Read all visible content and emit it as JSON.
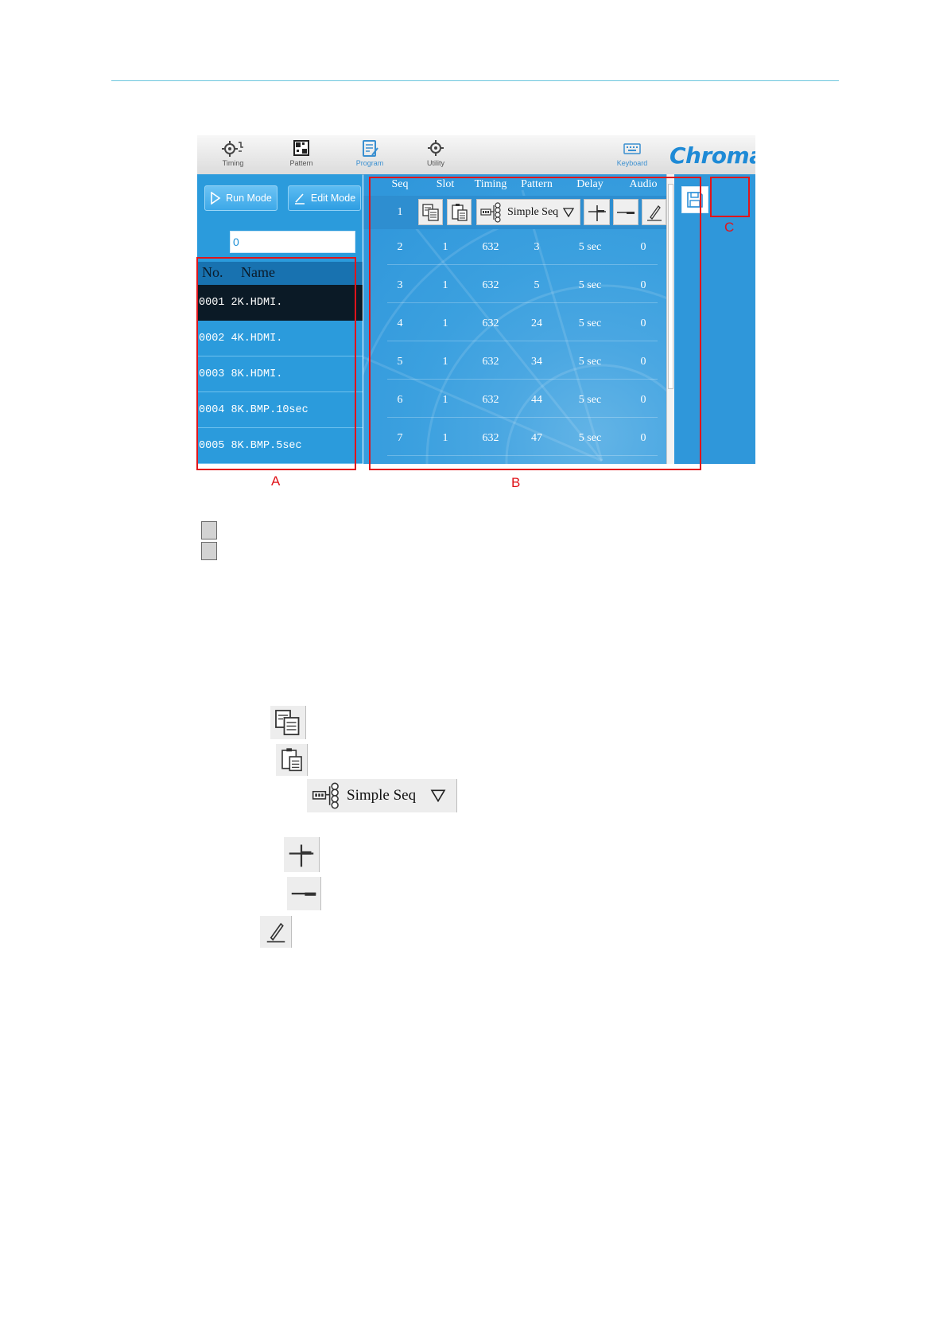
{
  "toolbar": {
    "items": [
      {
        "label": "Timing",
        "icon": "gear-wave-icon"
      },
      {
        "label": "Pattern",
        "icon": "pattern-icon"
      },
      {
        "label": "Program",
        "icon": "program-icon",
        "active": true
      },
      {
        "label": "Utility",
        "icon": "utility-gear-icon"
      }
    ],
    "keyboard_label": "Keyboard",
    "brand": "Chroma"
  },
  "modes": {
    "run_label": "Run Mode",
    "edit_label": "Edit Mode"
  },
  "search": {
    "value": "0"
  },
  "list": {
    "header_no": "No.",
    "header_name": "Name",
    "items": [
      {
        "text": "0001 2K.HDMI.",
        "selected": true
      },
      {
        "text": "0002 4K.HDMI."
      },
      {
        "text": "0003 8K.HDMI."
      },
      {
        "text": "0004 8K.BMP.10sec"
      },
      {
        "text": "0005 8K.BMP.5sec"
      }
    ]
  },
  "table": {
    "columns": [
      "Seq",
      "Slot",
      "Timing",
      "Pattern",
      "Delay",
      "Audio"
    ],
    "selected_seq": "1",
    "selected_dropdown": "Simple Seq",
    "rows": [
      [
        "2",
        "1",
        "632",
        "3",
        "5 sec",
        "0"
      ],
      [
        "3",
        "1",
        "632",
        "5",
        "5 sec",
        "0"
      ],
      [
        "4",
        "1",
        "632",
        "24",
        "5 sec",
        "0"
      ],
      [
        "5",
        "1",
        "632",
        "34",
        "5 sec",
        "0"
      ],
      [
        "6",
        "1",
        "632",
        "44",
        "5 sec",
        "0"
      ],
      [
        "7",
        "1",
        "632",
        "47",
        "5 sec",
        "0"
      ]
    ]
  },
  "callouts": {
    "a": "A",
    "b": "B",
    "c": "C"
  },
  "legend": {
    "dropdown_label": "Simple Seq"
  },
  "colors": {
    "accent": "#2b9bdc",
    "callout": "#e0151b",
    "rule": "#6cc6de"
  }
}
